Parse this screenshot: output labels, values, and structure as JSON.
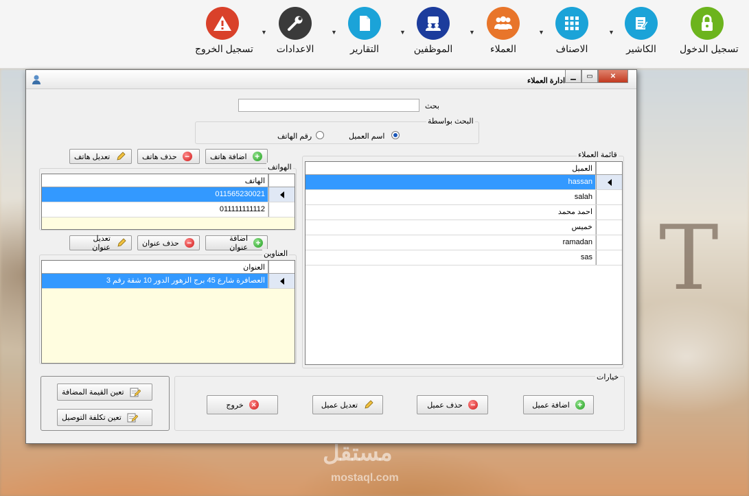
{
  "toolbar": {
    "items": [
      {
        "label": "تسجيل الدخول",
        "icon": "lock-icon",
        "color": "#6cb41d"
      },
      {
        "label": "الكاشير",
        "icon": "notepad-icon",
        "color": "#1ba3d8"
      },
      {
        "label": "الاصناف",
        "icon": "grid-icon",
        "color": "#1ba3d8"
      },
      {
        "label": "العملاء",
        "icon": "users-icon",
        "color": "#e8752a"
      },
      {
        "label": "الموظفين",
        "icon": "employees-icon",
        "color": "#1c3c9c"
      },
      {
        "label": "التقارير",
        "icon": "document-icon",
        "color": "#1ba3d8"
      },
      {
        "label": "الاعدادات",
        "icon": "wrench-icon",
        "color": "#3a3a3a"
      },
      {
        "label": "تسجيل الخروج",
        "icon": "warning-icon",
        "color": "#d9412a"
      }
    ]
  },
  "dialog": {
    "title": "ادارة العملاء",
    "search": {
      "label": "بحث",
      "value": ""
    },
    "search_by": {
      "label": "البحث بواسطة",
      "option_name": "اسم العميل",
      "option_phone": "رقم الهاتف",
      "selected": "اسم العميل"
    },
    "customers": {
      "group_label": "قائمة العملاء",
      "column": "العميل",
      "rows": [
        "hassan",
        "salah",
        "احمد محمد",
        "خميس",
        "ramadan",
        "sas"
      ],
      "selected_index": 0
    },
    "phones": {
      "group_label": "الهواتف",
      "column": "الهاتف",
      "rows": [
        "011565230021",
        "011111111112"
      ],
      "selected_index": 0,
      "add_label": "اضافة هاتف",
      "delete_label": "حذف هاتف",
      "edit_label": "تعديل هاتف"
    },
    "addresses": {
      "group_label": "العناوين",
      "column": "العنوان",
      "rows": [
        "العصافرة شارع 45 برج الزهور الدور 10 شقة رقم 3"
      ],
      "selected_index": 0,
      "add_label": "اضافة عنوان",
      "delete_label": "حذف عنوان",
      "edit_label": "تعديل عنوان"
    },
    "options": {
      "group_label": "خيارات",
      "add_customer": "اضافة عميل",
      "delete_customer": "حذف عميل",
      "edit_customer": "تعديل عميل",
      "exit": "خروج"
    },
    "side": {
      "set_vat": "تعين القيمة المضافة",
      "set_delivery": "تعين تكلفة التوصيل"
    }
  },
  "watermark": {
    "text": "مستقل",
    "url": "mostaql.com"
  }
}
